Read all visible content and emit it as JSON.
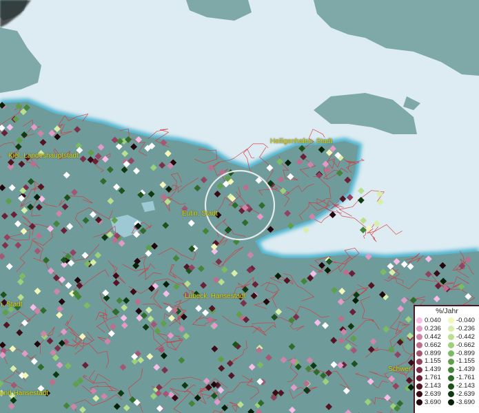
{
  "map": {
    "place_labels": [
      {
        "id": "kiel",
        "text": "Kiel, Landeshauptstadt"
      },
      {
        "id": "heiligenhafen",
        "text": "Heiligenhafen, Stadt"
      },
      {
        "id": "eutin",
        "text": "Eutin, Stadt"
      },
      {
        "id": "luebeck",
        "text": "Lübeck, Hansestadt"
      },
      {
        "id": "stadt-left",
        "text": "n, Stadt"
      },
      {
        "id": "hansestadt-left",
        "text": "und Hansestadt"
      },
      {
        "id": "schwerin",
        "text": "Schwer"
      }
    ],
    "colors": {
      "sea": "#dcecf2",
      "land": "#6f9c9b",
      "borders": "#d4383e",
      "coast_glow": "#4fb4cf",
      "selection_ring": "#f4f4f4"
    }
  },
  "legend": {
    "title": "%/Jahr",
    "positive": [
      {
        "value": "0.040",
        "color": "#f7bde6"
      },
      {
        "value": "0.236",
        "color": "#e39ac8"
      },
      {
        "value": "0.442",
        "color": "#cf85a8"
      },
      {
        "value": "0.662",
        "color": "#bb6f8d"
      },
      {
        "value": "0.899",
        "color": "#a45775"
      },
      {
        "value": "1.155",
        "color": "#91435f"
      },
      {
        "value": "1.439",
        "color": "#7d3049"
      },
      {
        "value": "1.761",
        "color": "#6a2036"
      },
      {
        "value": "2.143",
        "color": "#531424"
      },
      {
        "value": "2.639",
        "color": "#3b0b16"
      },
      {
        "value": "3.690",
        "color": "#22060b"
      }
    ],
    "negative": [
      {
        "value": "-0.040",
        "color": "#f3f7b9"
      },
      {
        "value": "-0.236",
        "color": "#d7efa8"
      },
      {
        "value": "-0.442",
        "color": "#b8e08e"
      },
      {
        "value": "-0.662",
        "color": "#9cd07a"
      },
      {
        "value": "-0.899",
        "color": "#7dbb62"
      },
      {
        "value": "-1.155",
        "color": "#5f9f4b"
      },
      {
        "value": "-1.439",
        "color": "#44853a"
      },
      {
        "value": "-1.761",
        "color": "#2f6c2c"
      },
      {
        "value": "-2.143",
        "color": "#1d521d"
      },
      {
        "value": "-2.639",
        "color": "#0f3a11"
      },
      {
        "value": "-3.690",
        "color": "#052007"
      }
    ]
  }
}
